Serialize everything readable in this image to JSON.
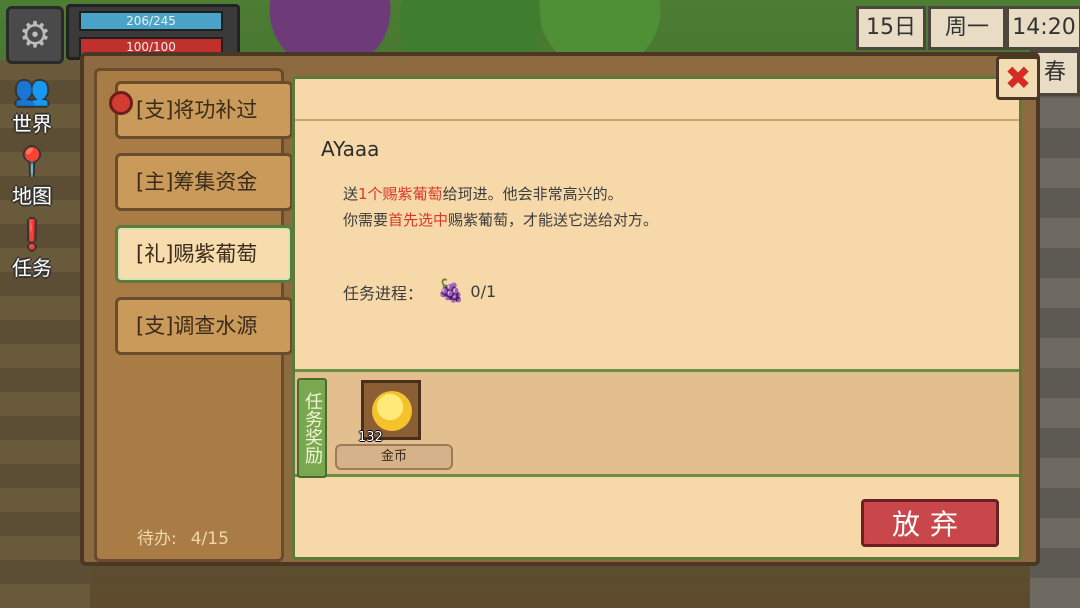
{
  "hud": {
    "hp": "206/245",
    "mp": "100/100",
    "date": "15日",
    "weekday": "周一",
    "time": "14:20",
    "season": "春"
  },
  "side_menu": [
    {
      "label": "世界",
      "icon": "people-icon"
    },
    {
      "label": "地图",
      "icon": "map-pin-icon"
    },
    {
      "label": "任务",
      "icon": "quest-icon"
    }
  ],
  "quests": [
    {
      "label": "[支]将功补过"
    },
    {
      "label": "[主]筹集资金"
    },
    {
      "label": "[礼]赐紫葡萄",
      "active": true
    },
    {
      "label": "[支]调查水源"
    }
  ],
  "todo": {
    "label": "待办:",
    "value": "4/15"
  },
  "detail": {
    "title": "AYaaa",
    "line1_a": "送",
    "line1_hl": "1个赐紫葡萄",
    "line1_b": "给珂进。他会非常高兴的。",
    "line2_a": "你需要",
    "line2_hl": "首先选中",
    "line2_b": "赐紫葡萄，才能送它送给对方。",
    "progress_label": "任务进程：",
    "progress_value": "0/1"
  },
  "reward": {
    "label": "任务奖励",
    "item_name": "金币",
    "item_count": "132"
  },
  "buttons": {
    "abandon": "放弃"
  }
}
